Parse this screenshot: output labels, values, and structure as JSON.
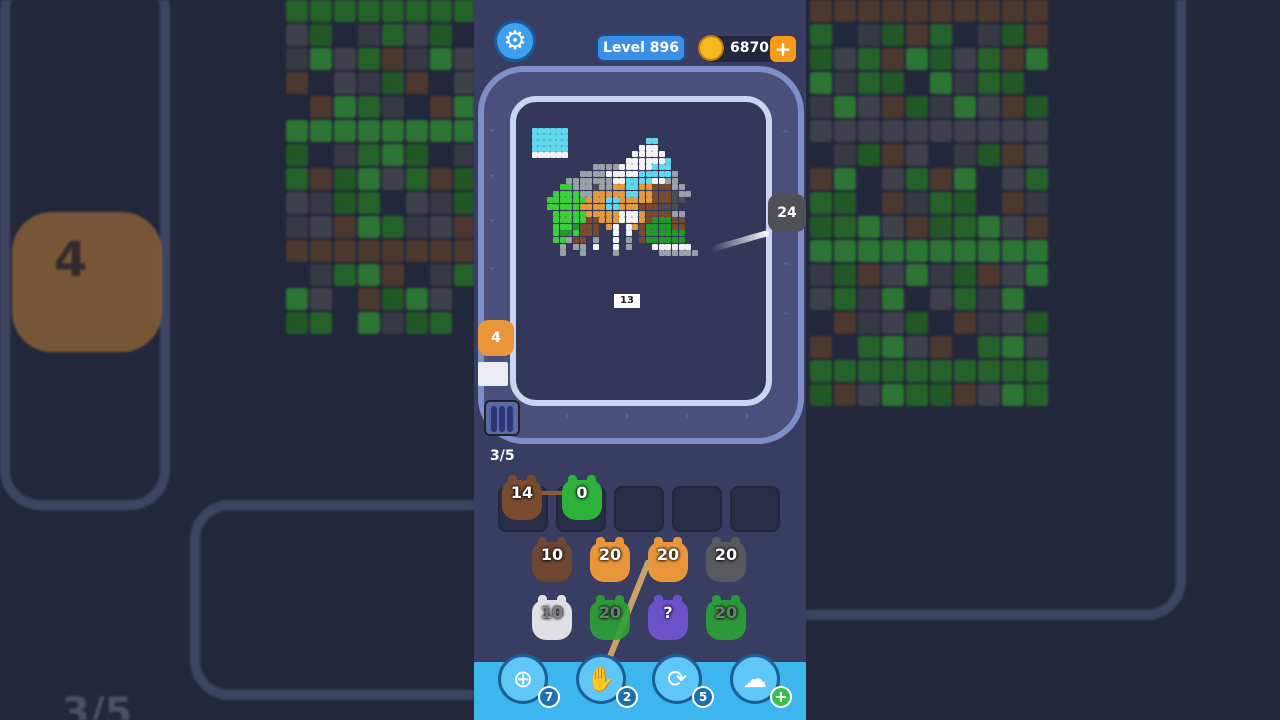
{
  "header": {
    "level": "Level 896",
    "coins": "6870",
    "coin_add": "+"
  },
  "board": {
    "pixel_label": "13",
    "shooter_right_ammo": "24",
    "shooter_left_ammo": "4",
    "capacity": "3/5"
  },
  "queue": [
    {
      "ammo": "14",
      "color": "#7a4a2e"
    },
    {
      "ammo": "0",
      "color": "#2db23a"
    }
  ],
  "units_row1": [
    {
      "ammo": "10",
      "color": "#6e4730"
    },
    {
      "ammo": "20",
      "color": "#e9963a"
    },
    {
      "ammo": "20",
      "color": "#e9963a"
    },
    {
      "ammo": "20",
      "color": "#58595e"
    }
  ],
  "units_row2": [
    {
      "ammo": "10",
      "color": "#f2f2f2"
    },
    {
      "ammo": "20",
      "color": "#2aa336"
    },
    {
      "ammo": "?",
      "color": "#6b52c8"
    },
    {
      "ammo": "20",
      "color": "#2aa336"
    }
  ],
  "boosters": [
    {
      "name": "add-slot",
      "count": "7"
    },
    {
      "name": "hand",
      "count": "2"
    },
    {
      "name": "shuffle",
      "count": "5"
    },
    {
      "name": "magnet",
      "count": "+"
    }
  ],
  "background": {
    "mascot_number": "4",
    "capacity_text": "3/5"
  }
}
